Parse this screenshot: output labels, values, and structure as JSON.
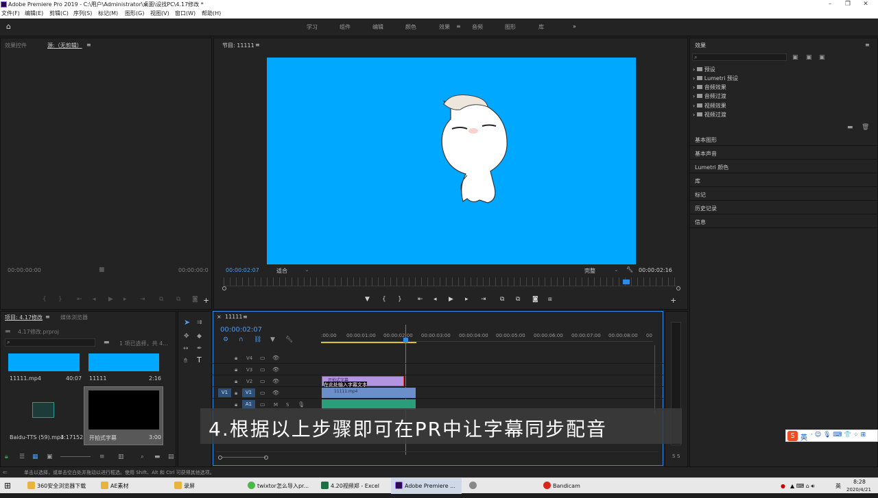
{
  "window": {
    "title": "Adobe Premiere Pro 2019 - C:\\用户\\Administrator\\桌面\\设找PC\\4.17修改 *"
  },
  "menu": [
    "文件(F)",
    "编辑(E)",
    "剪辑(C)",
    "序列(S)",
    "标记(M)",
    "图形(G)",
    "视图(V)",
    "窗口(W)",
    "帮助(H)"
  ],
  "workspaces": [
    "学习",
    "组件",
    "编辑",
    "颜色",
    "效果",
    "音频",
    "图形",
    "库"
  ],
  "workspaces_active": "效果",
  "left_top_tabs": {
    "effect_controls": "效果控件",
    "source": "源:（无剪辑）"
  },
  "source_monitor": {
    "time_left": "00:00:00:00",
    "time_right": "00:00:00:0"
  },
  "program_monitor": {
    "tab": "节目: 11111",
    "current_time": "00:00:02:07",
    "fit": "适合",
    "quality": "完整",
    "duration": "00:00:02:16",
    "preview_color": "#00a8ff"
  },
  "effects_panel": {
    "title": "效果",
    "tree": [
      "预设",
      "Lumetri 预设",
      "音频效果",
      "音频过渡",
      "视频效果",
      "视频过渡"
    ],
    "sections": [
      "基本图形",
      "基本声音",
      "Lumetri 颜色",
      "库",
      "标记",
      "历史记录",
      "信息"
    ]
  },
  "project_panel": {
    "tab": "项目: 4.17修改",
    "media_tab": "媒体浏览器",
    "project_file": "4.17修改.prproj",
    "selection": "1 项已选择，共 4...",
    "items": [
      {
        "name": "11111.mp4",
        "duration": "40:07"
      },
      {
        "name": "11111",
        "duration": "2:16"
      },
      {
        "name": "Baidu-TTS (59).mp3",
        "duration": "4:17152"
      },
      {
        "name": "开拍式字幕",
        "duration": "3:00"
      }
    ]
  },
  "timeline": {
    "tab": "11111",
    "current_time": "00:00:02:07",
    "ruler": [
      ":00:00",
      "00:00:01:00",
      "00:00:02:00",
      "00:00:03:00",
      "00:00:04:00",
      "00:00:05:00",
      "00:00:06:00",
      "00:00:07:00",
      "00:00:08:00",
      "00"
    ],
    "tracks": [
      "V4",
      "V3",
      "V2",
      "V1",
      "A1"
    ],
    "source_patch": "V1",
    "clip_v2_label": "开拍式字幕",
    "clip_v2_text": "在此处输入字幕文本",
    "clip_v1_label": "11111.mp4",
    "audio_track_buttons": [
      "M",
      "S"
    ]
  },
  "meter_labels": [
    "S",
    "S"
  ],
  "caption": "4.根据以上步骤即可在PR中让字幕同步配音",
  "status_bar": "单击以选择，或单击空白处并拖动以进行框选。使用 Shift、Alt 和 Ctrl 可获得其他选项。",
  "taskbar": {
    "items": [
      "360安全浏览器下载",
      "AE素材",
      "录屏",
      "twixtor怎么导入pr...",
      "4.20视频郑 - Excel",
      "Adobe Premiere ...",
      "Bandicam"
    ],
    "ime": "英",
    "clock_time": "8:28",
    "clock_date": "2020/4/21"
  },
  "ime_bar": {
    "logo": "S",
    "lang": "英"
  }
}
